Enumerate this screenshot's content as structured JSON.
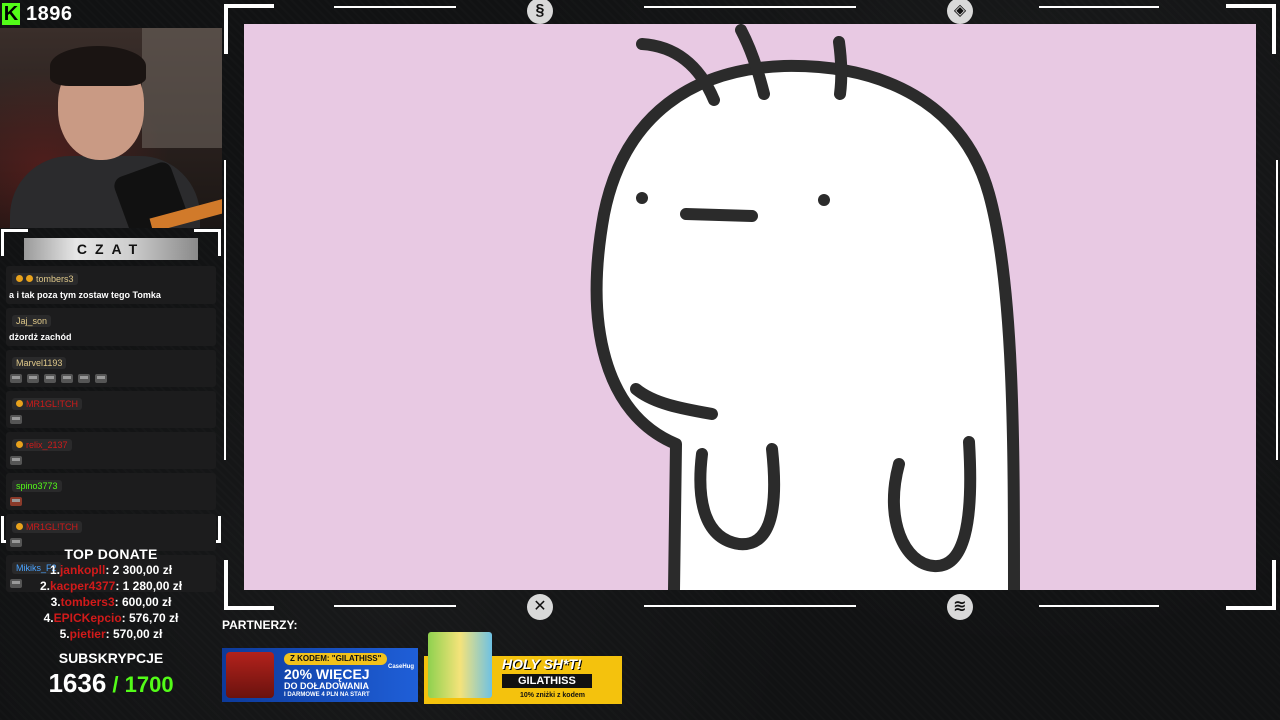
{
  "viewers": {
    "platform_icon": "kick-logo-icon",
    "platform_letter": "K",
    "count": "1896"
  },
  "chat": {
    "header": "CZAT",
    "messages": [
      {
        "user": "tombers3",
        "user_color": "#e0c98a",
        "badges": 2,
        "text": "a i tak poza tym zostaw tego Tomka",
        "emotes": 0
      },
      {
        "user": "Jaj_son",
        "user_color": "#e0c98a",
        "badges": 0,
        "text": "dżordż zachód",
        "emotes": 0
      },
      {
        "user": "Marvel1193",
        "user_color": "#e0c98a",
        "badges": 0,
        "text": "",
        "emotes": 6
      },
      {
        "user": "MR1GL!TCH",
        "user_color": "#d11a1a",
        "badges": 1,
        "text": "",
        "emotes": 1
      },
      {
        "user": "relix_2137",
        "user_color": "#d11a1a",
        "badges": 1,
        "text": "",
        "emotes": 1
      },
      {
        "user": "spino3773",
        "user_color": "#53fc18",
        "badges": 0,
        "text": "",
        "emotes": 1,
        "emote_red": true
      },
      {
        "user": "MR1GL!TCH",
        "user_color": "#d11a1a",
        "badges": 1,
        "text": "",
        "emotes": 1
      },
      {
        "user": "Mikiks_F2",
        "user_color": "#4aa3ff",
        "badges": 0,
        "text": "",
        "emotes": 1
      }
    ]
  },
  "top_donate": {
    "title": "TOP DONATE",
    "entries": [
      {
        "rank": "1.",
        "name": "jankopll",
        "amount": ": 2 300,00 zł"
      },
      {
        "rank": "2.",
        "name": "kacper4377",
        "amount": ": 1 280,00 zł"
      },
      {
        "rank": "3.",
        "name": "tombers3",
        "amount": ": 600,00 zł"
      },
      {
        "rank": "4.",
        "name": "EPICKepcio",
        "amount": ": 576,70 zł"
      },
      {
        "rank": "5.",
        "name": "pietier",
        "amount": ": 570,00 zł"
      }
    ]
  },
  "subscriptions": {
    "title": "SUBSKRYPCJE",
    "current": "1636",
    "goal": " / 1700"
  },
  "partners": {
    "label": "PARTNERZY:",
    "ad1": {
      "pill": "Z KODEM: \"GILATHISS\"",
      "percent": "20% WIĘCEJ",
      "line2": "DO DOŁADOWANIA",
      "line3": "I DARMOWE 4 PLN NA START",
      "brand": "CaseHug"
    },
    "ad2": {
      "headline": "HOLY SH*T!",
      "code": "GILATHISS",
      "small": "10% zniżki z kodem"
    }
  },
  "frame_icons": [
    "swirl-logo-icon",
    "compass-logo-icon",
    "crosshatch-logo-icon",
    "wave-logo-icon"
  ],
  "colors": {
    "canvas_bg": "#e8c9e3",
    "accent_green": "#53fc18",
    "donor_red": "#d11a1a"
  }
}
